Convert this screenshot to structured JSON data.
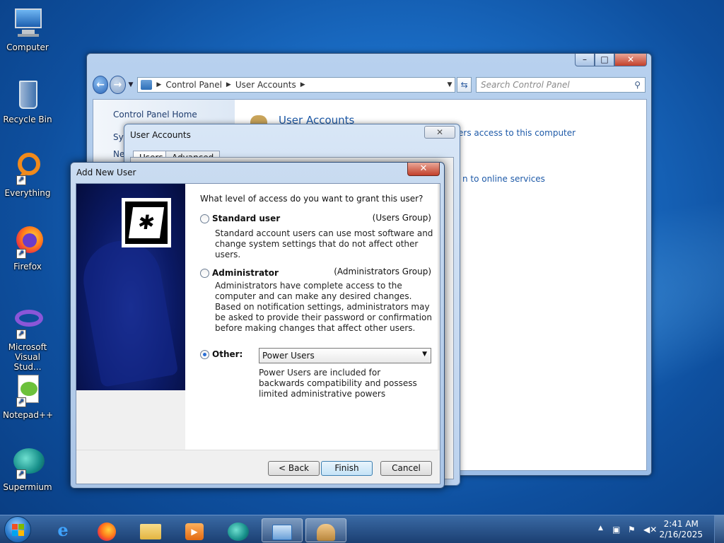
{
  "desktop": {
    "icons": [
      {
        "label": "Computer"
      },
      {
        "label": "Recycle Bin"
      },
      {
        "label": "Everything"
      },
      {
        "label": "Firefox"
      },
      {
        "label": "Microsoft Visual Stud..."
      },
      {
        "label": "Notepad++"
      },
      {
        "label": "Supermium"
      }
    ]
  },
  "control_panel": {
    "address": [
      "Control Panel",
      "User Accounts"
    ],
    "search_placeholder": "Search Control Panel",
    "left_links": [
      "Control Panel Home",
      "Sys",
      "Ne"
    ],
    "title": "User Accounts",
    "links": [
      "ers access to this computer",
      "n to online services"
    ]
  },
  "user_accounts_dialog": {
    "title": "User Accounts",
    "tabs": [
      "Users",
      "Advanced"
    ]
  },
  "add_new_user": {
    "title": "Add New User",
    "question": "What level of access do you want to grant this user?",
    "options": [
      {
        "label": "Standard user",
        "group": "(Users Group)",
        "description": "Standard account users can use most software and change system settings that do not affect other users.",
        "selected": false
      },
      {
        "label": "Administrator",
        "group": "(Administrators Group)",
        "description": "Administrators have complete access to the computer and can make any desired changes. Based on notification settings, administrators may be asked to provide their password or confirmation before making changes that affect other users.",
        "selected": false
      },
      {
        "label": "Other:",
        "selected": true,
        "select_value": "Power Users",
        "description": "Power Users are included for backwards compatibility and possess limited administrative powers"
      }
    ],
    "buttons": {
      "back": "< Back",
      "finish": "Finish",
      "cancel": "Cancel"
    }
  },
  "taskbar": {
    "time": "2:41 AM",
    "date": "2/16/2025"
  }
}
